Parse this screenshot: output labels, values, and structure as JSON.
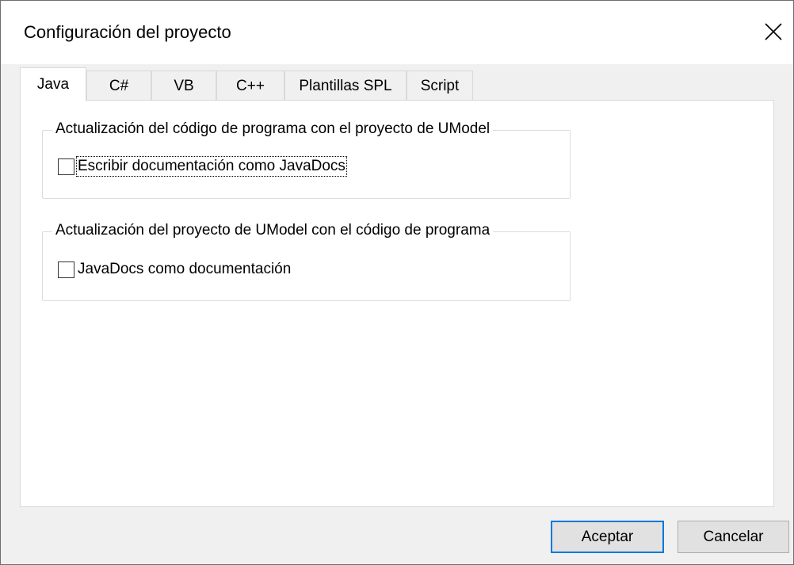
{
  "window": {
    "title": "Configuración del proyecto",
    "close_icon": "close-icon"
  },
  "tabs": [
    {
      "label": "Java",
      "active": true
    },
    {
      "label": "C#",
      "active": false
    },
    {
      "label": "VB",
      "active": false
    },
    {
      "label": "C++",
      "active": false
    },
    {
      "label": "Plantillas SPL",
      "active": false
    },
    {
      "label": "Script",
      "active": false
    }
  ],
  "groups": [
    {
      "legend": "Actualización del código de programa con el proyecto de UModel",
      "checkbox": {
        "label": "Escribir documentación como JavaDocs",
        "checked": false
      }
    },
    {
      "legend": "Actualización del proyecto de UModel con el código de programa",
      "checkbox": {
        "label": "JavaDocs como documentación",
        "checked": false
      }
    }
  ],
  "buttons": {
    "ok_label": "Aceptar",
    "cancel_label": "Cancelar"
  },
  "colors": {
    "default_button_border": "#0078d7",
    "dialog_background": "#f0f0f0"
  }
}
